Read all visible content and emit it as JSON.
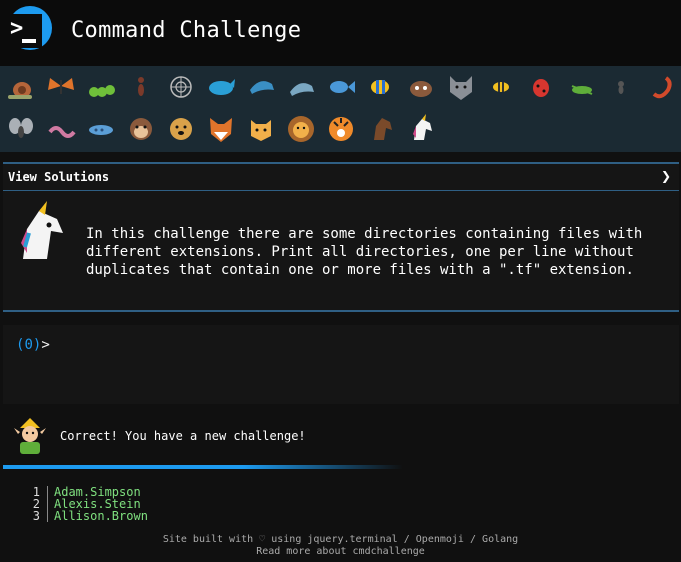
{
  "app": {
    "title": "Command Challenge",
    "logo_icon": "terminal-prompt-icon",
    "colors": {
      "accent": "#1d9bf0",
      "background": "#101010",
      "panel": "#151515",
      "strip": "#1b2a33"
    }
  },
  "emoji_strip": {
    "row1": [
      "snail-icon",
      "butterfly-icon",
      "caterpillar-icon",
      "ant-icon",
      "spider-web-icon",
      "whale-icon",
      "dolphin-icon",
      "dolphin-icon",
      "fish-icon",
      "tropical-fish-icon",
      "hedgehog-icon",
      "wolf-icon",
      "bee-icon",
      "lady-beetle-icon",
      "cricket-icon",
      "ant-icon",
      "scorpion-icon"
    ],
    "row2": [
      "fly-icon",
      "worm-icon",
      "microbe-icon",
      "monkey-icon",
      "dog-icon",
      "fox-icon",
      "cat-icon",
      "lion-icon",
      "tiger-icon",
      "horse-icon",
      "unicorn-icon"
    ]
  },
  "view_solutions": {
    "label": "View Solutions",
    "chevron": "❯"
  },
  "challenge": {
    "icon": "unicorn-icon",
    "text": "In this challenge there are some directories containing files with different extensions. Print all directories, one per line without duplicates that contain one or more files with a \".tf\" extension."
  },
  "terminal": {
    "prompt_open": "(",
    "prompt_count": "0",
    "prompt_close": ")",
    "prompt_gt": ">"
  },
  "status": {
    "icon": "elf-icon",
    "message": "Correct! You have a new challenge!",
    "progress": 0.6
  },
  "file_list": {
    "rows": [
      {
        "num": "1",
        "name": "Adam.Simpson"
      },
      {
        "num": "2",
        "name": "Alexis.Stein"
      },
      {
        "num": "3",
        "name": "Allison.Brown"
      },
      {
        "num": "4",
        "name": ""
      }
    ]
  },
  "footer": {
    "site_built_with": "Site built with",
    "heart": "♡",
    "using": "using",
    "jquery_terminal": "jquery.terminal",
    "slash1": "/",
    "openmoji": "Openmoji",
    "slash2": "/",
    "golang": "Golang",
    "read_more": "Read more about cmdchallenge"
  }
}
